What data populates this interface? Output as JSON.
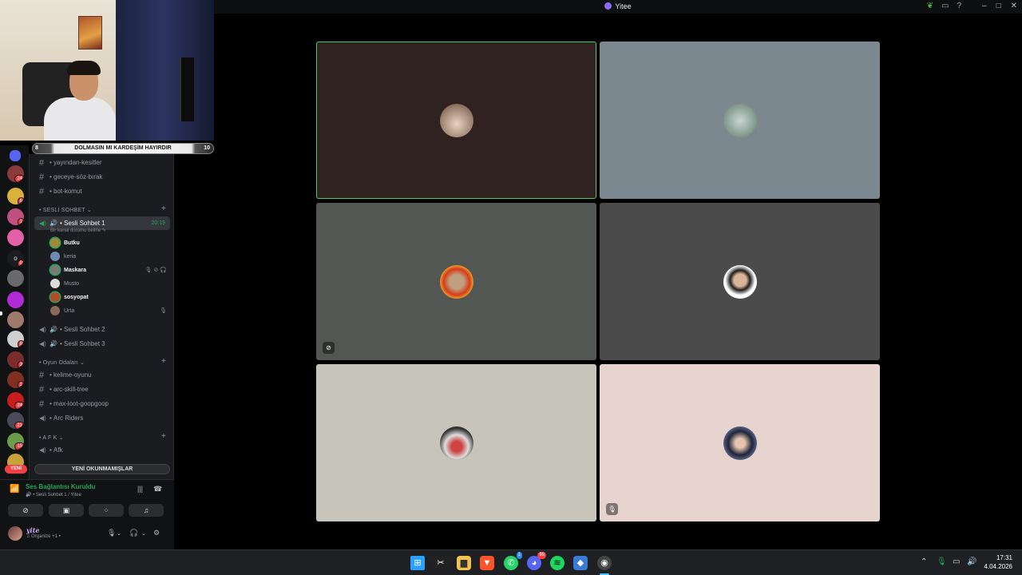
{
  "window": {
    "title": "Yitee"
  },
  "banner": {
    "left": "8",
    "text": "DOLMASIN MI KARDEŞİM HAYIRDIR",
    "right": "10"
  },
  "server_badges": [
    "24",
    "6",
    "1",
    "",
    "0",
    "",
    "",
    "",
    "8",
    "3",
    "1",
    "24",
    "21",
    "15",
    "",
    ""
  ],
  "new_label": "YENİ",
  "channels": {
    "text_top": [
      {
        "name": "yayından-kesitler"
      },
      {
        "name": "geceye-söz-bırak"
      },
      {
        "name": "bot-komut"
      }
    ],
    "voice_category": "SESLİ SOHBET",
    "active_voice": {
      "name": "Sesli Sohbet 1",
      "time": "20:19",
      "status": "Bir kanal durumu belirle"
    },
    "members": [
      {
        "name": "Butku",
        "speaking": true,
        "icons": ""
      },
      {
        "name": "keria",
        "speaking": false,
        "icons": ""
      },
      {
        "name": "Maskara",
        "speaking": true,
        "icons": "🎙 ⊘ 🎧"
      },
      {
        "name": "Musto",
        "speaking": false,
        "icons": ""
      },
      {
        "name": "sosyopat",
        "speaking": true,
        "icons": ""
      },
      {
        "name": "Urta",
        "speaking": false,
        "icons": "🎙"
      }
    ],
    "voice_other": [
      {
        "name": "Sesli Sohbet 2"
      },
      {
        "name": "Sesli Sohbet 3"
      }
    ],
    "game_category": "Oyun Odaları",
    "game_channels": [
      {
        "name": "kelime-oyunu",
        "type": "text"
      },
      {
        "name": "arc-skill-tree",
        "type": "text"
      },
      {
        "name": "max-loot-goopgoop",
        "type": "text"
      },
      {
        "name": "Arc Riders",
        "type": "forum"
      }
    ],
    "afk_category": "A F K",
    "afk_channel": "Afk",
    "unread_button": "YENİ OKUNMAMIŞLAR"
  },
  "voice_panel": {
    "status": "Ses Bağlantısı Kuruldu",
    "sub": "Sesli Sohbet 1 / Yitee",
    "user_name": "yite",
    "user_sub": "Organize +1 •"
  },
  "tiles_muted": [
    false,
    false,
    true,
    false,
    false,
    true
  ],
  "clock": {
    "time": "17:31",
    "date": "4.04.2026"
  },
  "taskbar_badges": {
    "whatsapp": "1",
    "discord": "99"
  },
  "colors": {
    "accent_green": "#23a559",
    "speaking_border": "#4fc96b",
    "brand": "#8b6cf6"
  }
}
